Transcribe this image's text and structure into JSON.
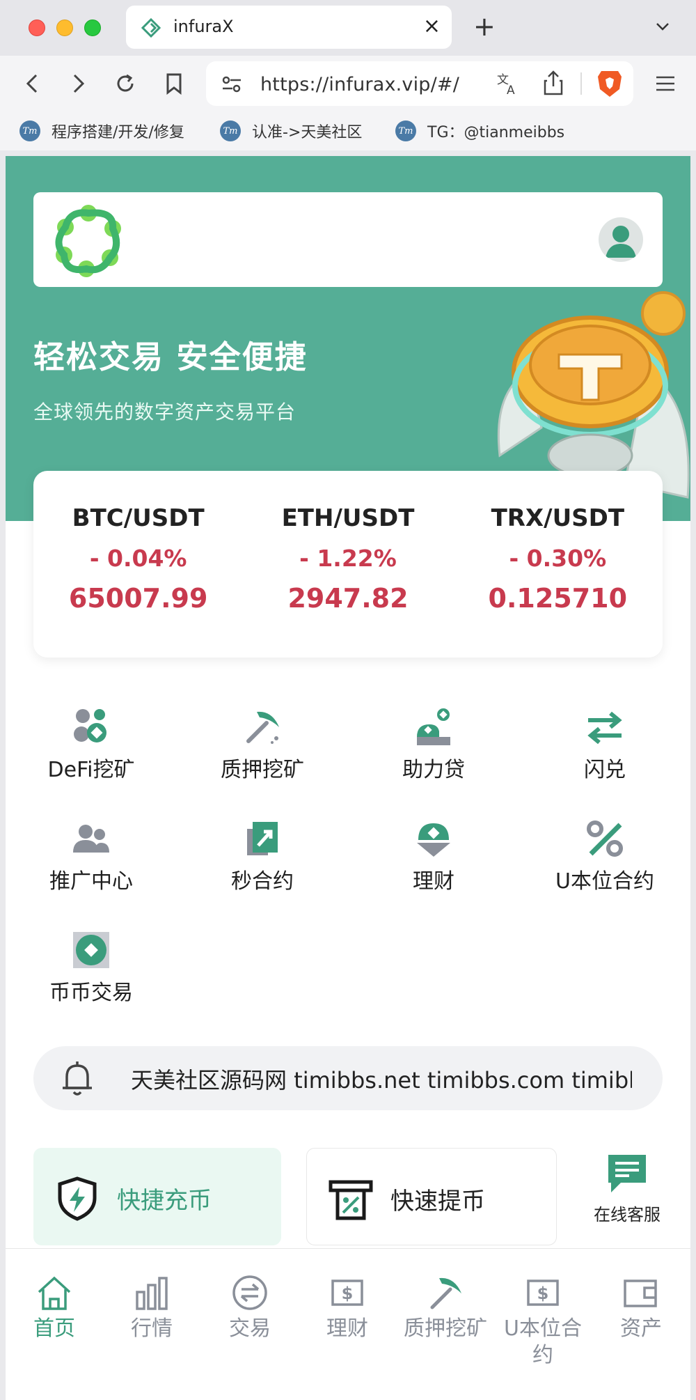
{
  "browser": {
    "tab_title": "infuraX",
    "url": "https://infurax.vip/#/",
    "bookmarks": [
      "程序搭建/开发/修复",
      "认准->天美社区",
      "TG：@tianmeibbs"
    ],
    "bookmark_icon_text": "Tm"
  },
  "hero": {
    "title": "轻松交易 安全便捷",
    "subtitle": "全球领先的数字资产交易平台"
  },
  "tickers": [
    {
      "pair": "BTC/USDT",
      "change": "- 0.04%",
      "price": "65007.99"
    },
    {
      "pair": "ETH/USDT",
      "change": "- 1.22%",
      "price": "2947.82"
    },
    {
      "pair": "TRX/USDT",
      "change": "- 0.30%",
      "price": "0.125710"
    }
  ],
  "features": [
    "DeFi挖矿",
    "质押挖矿",
    "助力贷",
    "闪兑",
    "推广中心",
    "秒合约",
    "理财",
    "U本位合约",
    "币币交易"
  ],
  "notice": "天美社区源码网 timibbs.net timibbs.com timibbs.vip",
  "quick": {
    "deposit": "快捷充币",
    "withdraw": "快速提币",
    "support": "在线客服"
  },
  "nav": [
    "首页",
    "行情",
    "交易",
    "理财",
    "质押挖矿",
    "U本位合约",
    "资产"
  ],
  "colors": {
    "brand": "#55ae96",
    "accent": "#3a9c7c",
    "down": "#c83a4e"
  }
}
